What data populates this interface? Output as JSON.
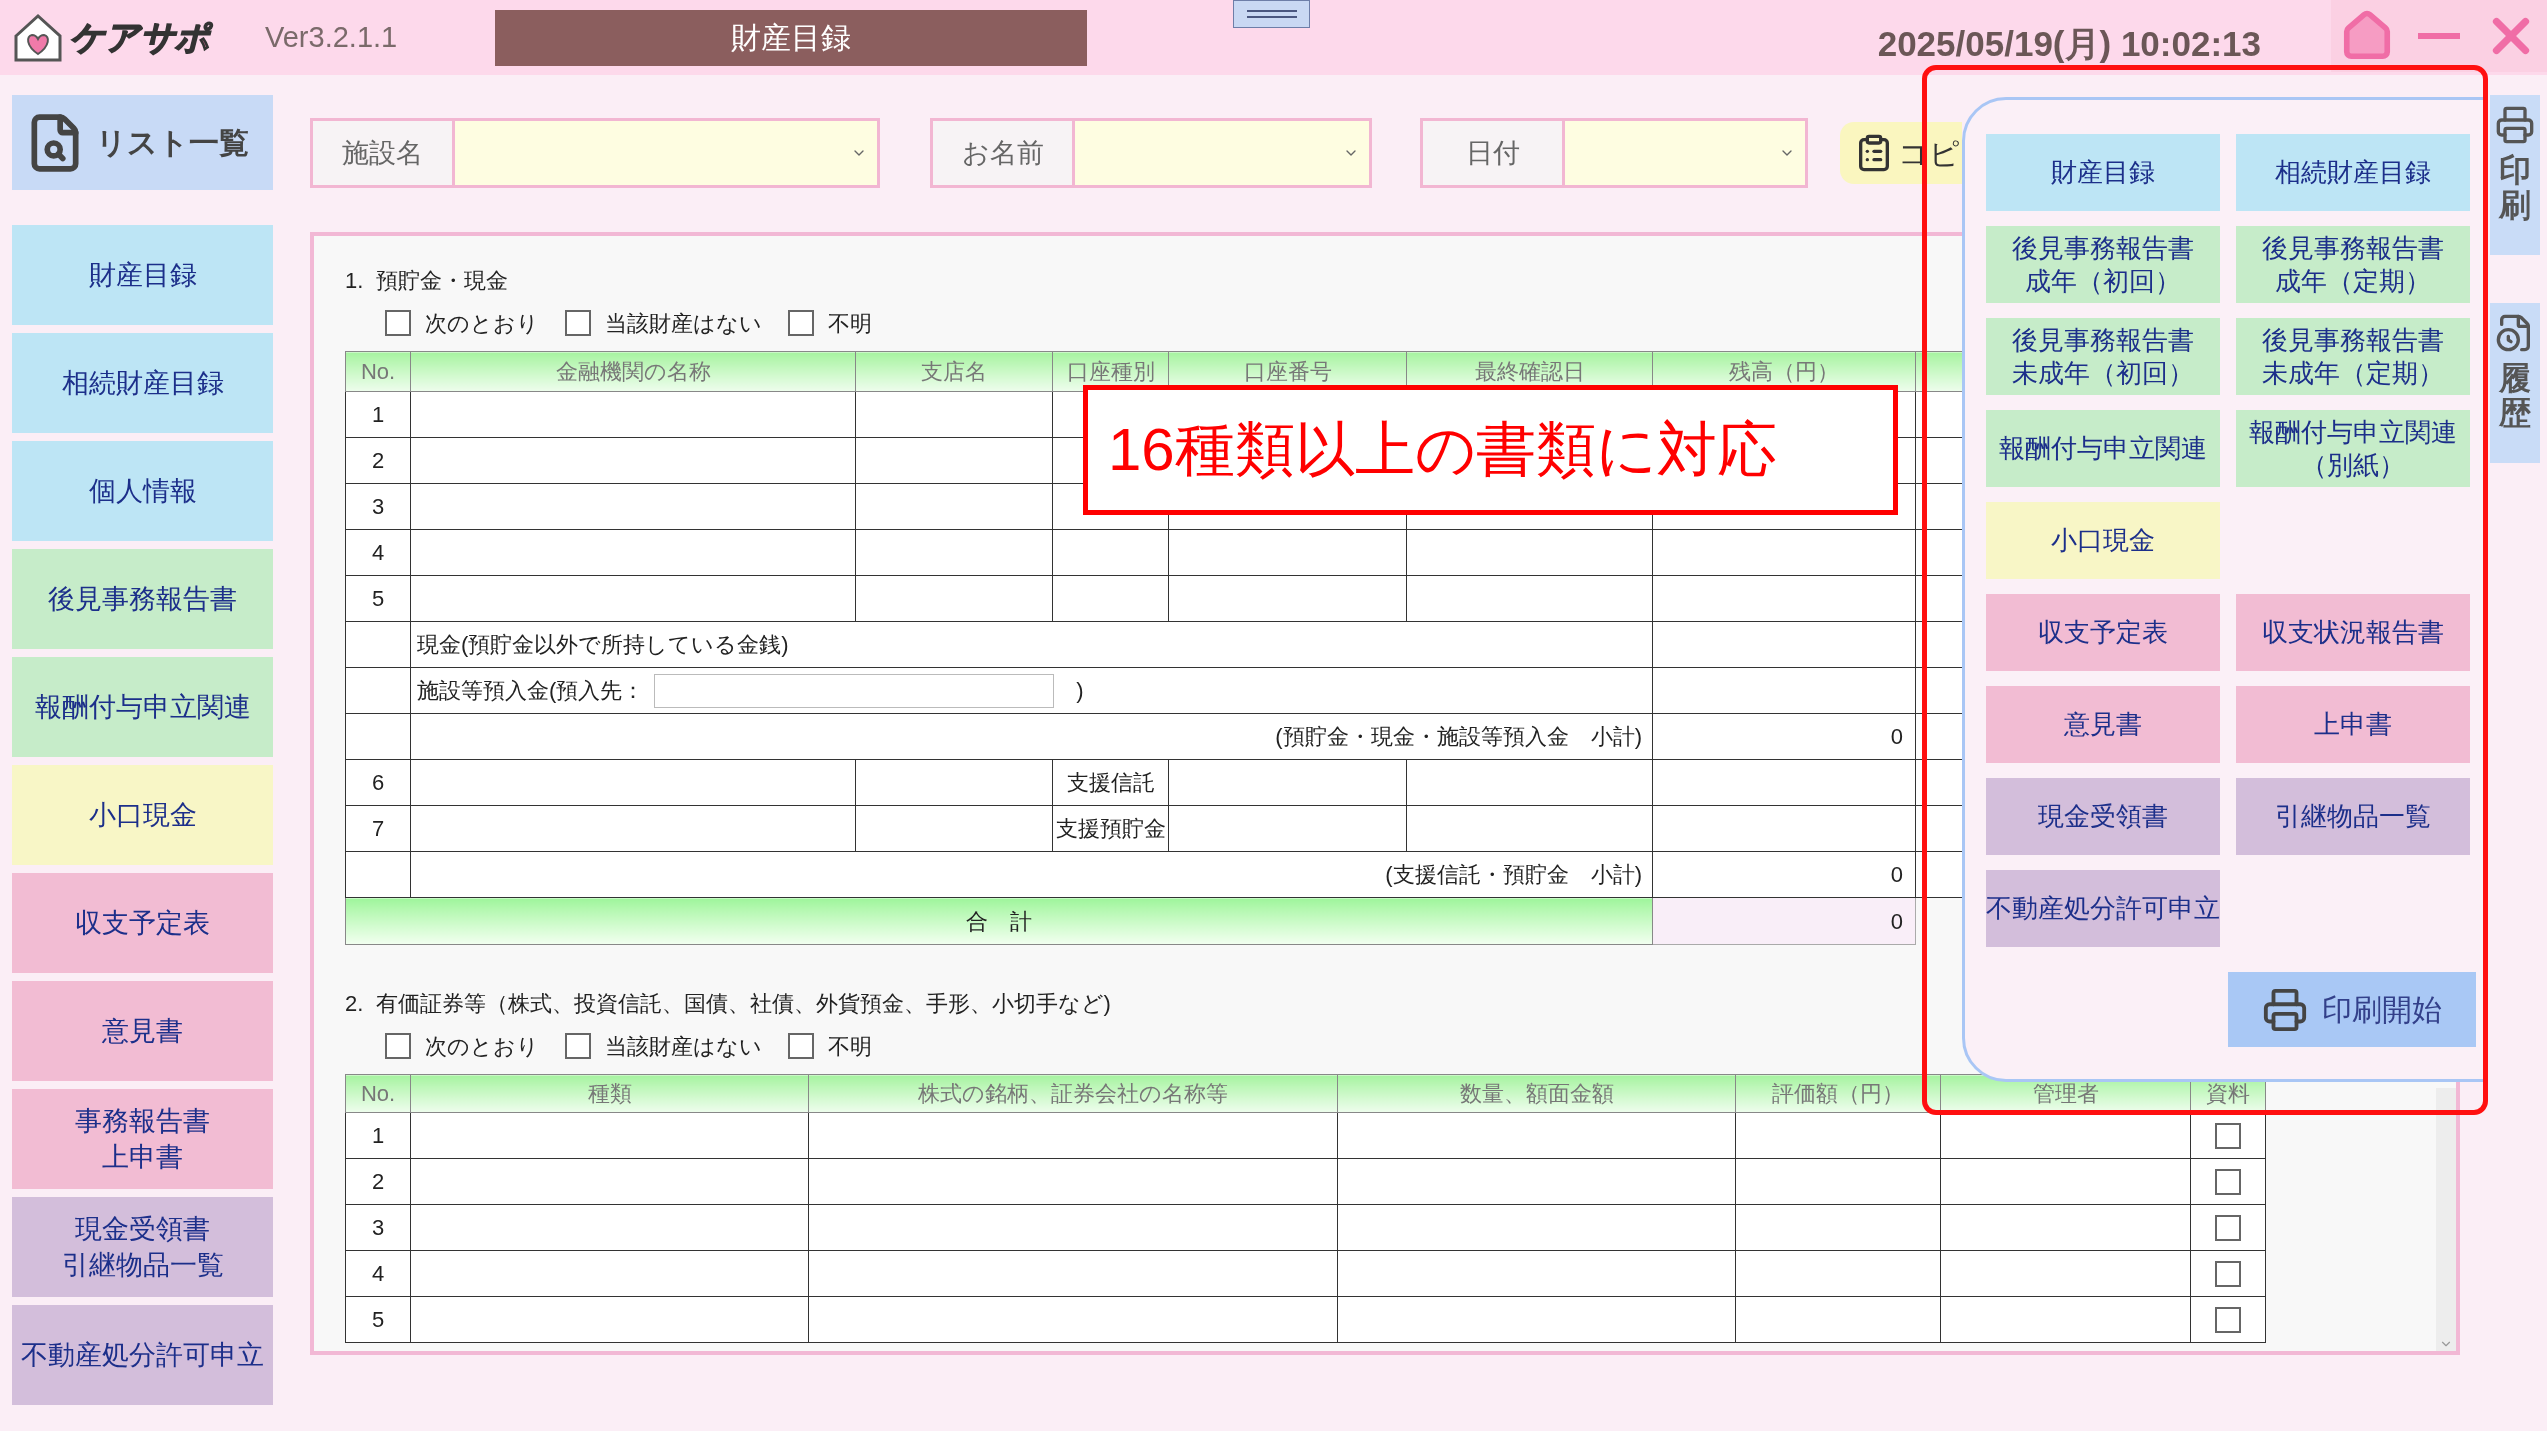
{
  "app": {
    "logo_text": "ケアサポ",
    "version": "Ver3.2.1.1",
    "title": "財産目録",
    "datetime": "2025/05/19(月) 10:02:13"
  },
  "list_button": "リスト一覧",
  "filters": [
    {
      "label": "施設名"
    },
    {
      "label": "お名前"
    },
    {
      "label": "日付"
    }
  ],
  "copy_button": "コピ",
  "sidebar": [
    {
      "label": "財産目録",
      "color": "#bde5f5"
    },
    {
      "label": "相続財産目録",
      "color": "#bde5f5"
    },
    {
      "label": "個人情報",
      "color": "#bde5f5"
    },
    {
      "label": "後見事務報告書",
      "color": "#c6ecc9"
    },
    {
      "label": "報酬付与申立関連",
      "color": "#c6ecc9"
    },
    {
      "label": "小口現金",
      "color": "#f8f6c6"
    },
    {
      "label": "収支予定表",
      "color": "#f2bcd3"
    },
    {
      "label": "意見書",
      "color": "#f2bcd3"
    },
    {
      "lines": [
        "事務報告書",
        "上申書"
      ],
      "color": "#f2bcd3"
    },
    {
      "lines": [
        "現金受領書",
        "引継物品一覧"
      ],
      "color": "#d3bedb"
    },
    {
      "label": "不動産処分許可申立",
      "color": "#d3bedb"
    }
  ],
  "section1": {
    "heading": "1.  預貯金・現金",
    "options": [
      {
        "label": "次のとおり",
        "checked": false
      },
      {
        "label": "当該財産はない",
        "checked": false
      },
      {
        "label": "不明",
        "checked": false
      }
    ],
    "columns": [
      "No.",
      "金融機関の名称",
      "支店名",
      "口座種別",
      "口座番号",
      "最終確認日",
      "残高（円）"
    ],
    "rows": [
      {
        "kind": "account",
        "no": "1"
      },
      {
        "kind": "account",
        "no": "2"
      },
      {
        "kind": "account",
        "no": "3"
      },
      {
        "kind": "account",
        "no": "4"
      },
      {
        "kind": "account",
        "no": "5"
      },
      {
        "kind": "text",
        "text": "現金(預貯金以外で所持している金銭)"
      },
      {
        "kind": "deposit",
        "text": "施設等預入金(預入先：",
        "close": ")"
      },
      {
        "kind": "subtotal",
        "label": "(預貯金・現金・施設等預入金　小計)",
        "value": "0"
      },
      {
        "kind": "account",
        "no": "6",
        "type": "支援信託"
      },
      {
        "kind": "account",
        "no": "7",
        "type": "支援預貯金"
      },
      {
        "kind": "subtotal",
        "label": "(支援信託・預貯金　小計)",
        "value": "0"
      },
      {
        "kind": "total",
        "label": "合　計",
        "value": "0"
      }
    ]
  },
  "section2": {
    "heading": "2.  有価証券等（株式、投資信託、国債、社債、外貨預金、手形、小切手など)",
    "options": [
      {
        "label": "次のとおり",
        "checked": false
      },
      {
        "label": "当該財産はない",
        "checked": false
      },
      {
        "label": "不明",
        "checked": false
      }
    ],
    "columns": [
      "No.",
      "種類",
      "株式の銘柄、証券会社の名称等",
      "数量、額面金額",
      "評価額（円）",
      "管理者",
      "資料"
    ],
    "rows": [
      {
        "no": "1",
        "checked": false
      },
      {
        "no": "2",
        "checked": false
      },
      {
        "no": "3",
        "checked": false
      },
      {
        "no": "4",
        "checked": false
      },
      {
        "no": "5",
        "checked": false
      }
    ]
  },
  "callout": {
    "text": "16種類以上の書類に対応"
  },
  "print_panel": {
    "rows": [
      [
        {
          "label": "財産目録",
          "color": "#bde5f5"
        },
        {
          "label": "相続財産目録",
          "color": "#bde5f5"
        }
      ],
      [
        {
          "lines": [
            "後見事務報告書",
            "成年（初回）"
          ],
          "color": "#c6ecc9"
        },
        {
          "lines": [
            "後見事務報告書",
            "成年（定期）"
          ],
          "color": "#c6ecc9"
        }
      ],
      [
        {
          "lines": [
            "後見事務報告書",
            "未成年（初回）"
          ],
          "color": "#c6ecc9"
        },
        {
          "lines": [
            "後見事務報告書",
            "未成年（定期）"
          ],
          "color": "#c6ecc9"
        }
      ],
      [
        {
          "label": "報酬付与申立関連",
          "color": "#c6ecc9"
        },
        {
          "lines": [
            "報酬付与申立関連",
            "（別紙）"
          ],
          "color": "#c6ecc9"
        }
      ],
      [
        {
          "label": "小口現金",
          "color": "#f8f6c6"
        }
      ],
      [
        {
          "label": "収支予定表",
          "color": "#f2bcd3"
        },
        {
          "label": "収支状況報告書",
          "color": "#f2bcd3"
        }
      ],
      [
        {
          "label": "意見書",
          "color": "#f2bcd3"
        },
        {
          "label": "上申書",
          "color": "#f2bcd3"
        }
      ],
      [
        {
          "label": "現金受領書",
          "color": "#d3bedb"
        },
        {
          "label": "引継物品一覧",
          "color": "#d3bedb"
        }
      ],
      [
        {
          "label": "不動産処分許可申立",
          "color": "#d3bedb"
        }
      ]
    ],
    "start_button": "印刷開始"
  },
  "side_tabs": [
    {
      "kind": "print",
      "label": "印刷"
    },
    {
      "kind": "history",
      "label": "履歴"
    }
  ]
}
